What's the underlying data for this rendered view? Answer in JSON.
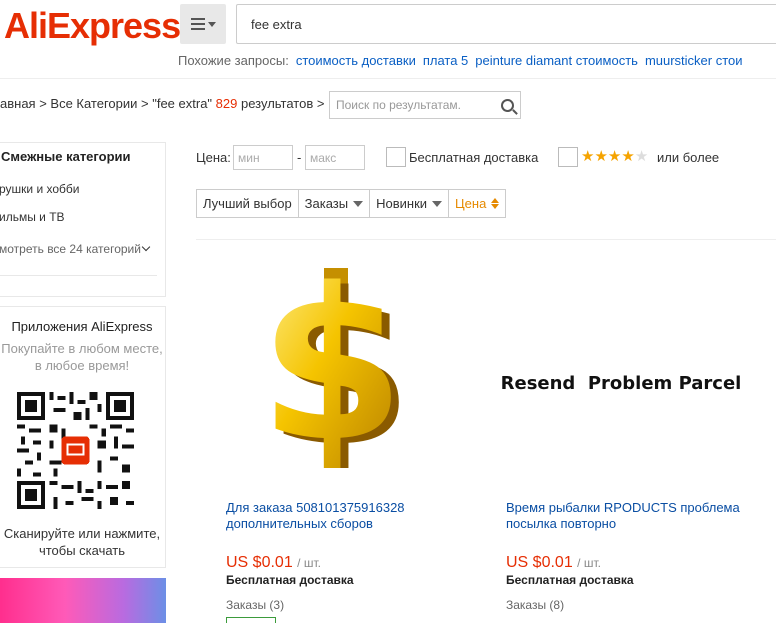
{
  "header": {
    "logo_text": "AliExpress",
    "logo_mark": "®",
    "search_value": "fee extra"
  },
  "related": {
    "label": "Похожие запросы:",
    "links": [
      "стоимость доставки",
      "плата 5",
      "peinture diamant стоимость",
      "muursticker стои"
    ]
  },
  "breadcrumb": {
    "text": "авная > Все Категории > \"fee extra\"",
    "count": "829",
    "suffix": "результатов >",
    "filter_placeholder": "Поиск по результатам."
  },
  "sidebar": {
    "categories_title": "Смежные категории",
    "categories": [
      "рушки и хобби",
      "ильмы и ТВ"
    ],
    "more_link": "мотреть все 24 категорий",
    "app_title": "Приложения AliExpress",
    "app_tagline": "Покупайте в любом месте, в любое время!",
    "app_cta": "Сканируйте или нажмите, чтобы скачать",
    "qr_center": "AliExpress"
  },
  "filters": {
    "price_label": "Цена:",
    "min_placeholder": "мин",
    "max_placeholder": "макс",
    "dash": "-",
    "free_shipping": "Бесплатная доставка",
    "rating_stars": 4,
    "or_more": "или более"
  },
  "sort": {
    "best": "Лучший выбор",
    "orders": "Заказы",
    "newest": "Новинки",
    "price": "Цена"
  },
  "products": [
    {
      "title": "Для заказа 508101375916328 дополнительных сборов",
      "price": "US $0.01",
      "unit": "/ шт.",
      "shipping": "Бесплатная доставка",
      "orders": "Заказы (3)",
      "image_icon": "dollar-sign-icon"
    },
    {
      "title": "Время рыбалки RPODUCTS проблема посылка повторно",
      "price": "US $0.01",
      "unit": "/ шт.",
      "shipping": "Бесплатная доставка",
      "orders": "Заказы (8)",
      "image_text": "Resend  Problem Parcel"
    }
  ],
  "colors": {
    "brand": "#e62e04",
    "link": "#0a5fc4",
    "active_sort": "#e68a00",
    "star": "#f5a300"
  }
}
